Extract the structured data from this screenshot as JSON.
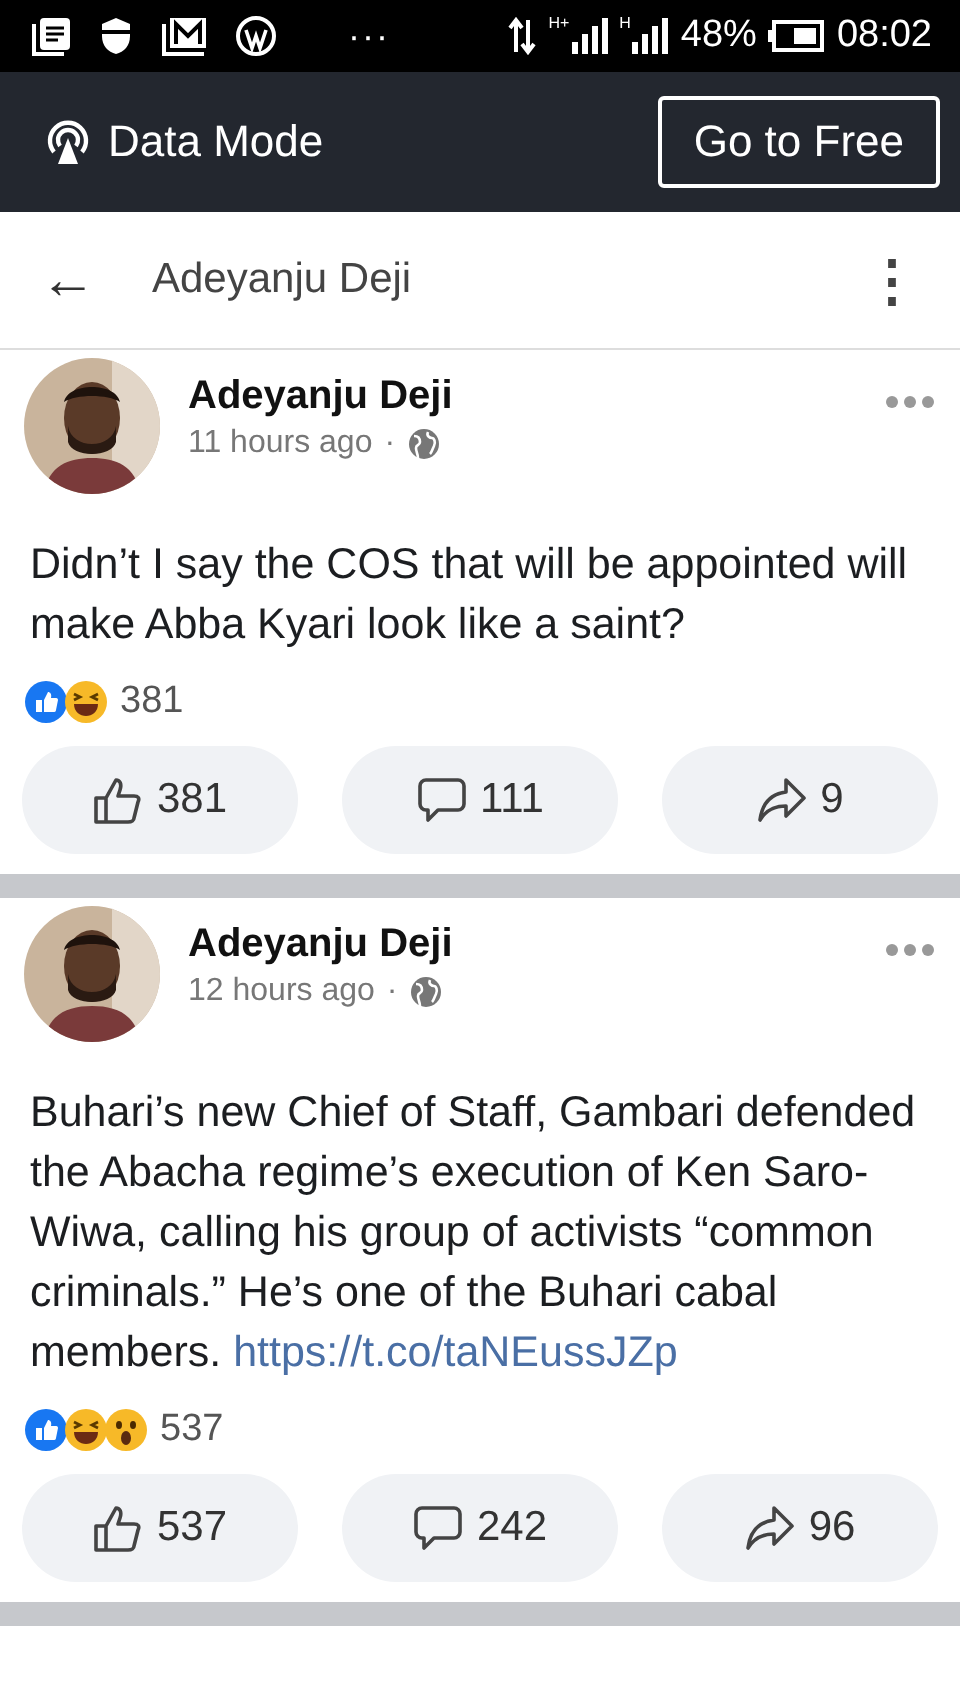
{
  "status_bar": {
    "battery": "48%",
    "time": "08:02",
    "network_labels": [
      "H+",
      "H"
    ],
    "more": "···"
  },
  "data_banner": {
    "label": "Data Mode",
    "button": "Go to Free"
  },
  "header": {
    "back": "←",
    "title": "Adeyanju Deji",
    "menu": "⋮"
  },
  "posts": [
    {
      "author": "Adeyanju Deji",
      "time": "11 hours ago",
      "separator": "·",
      "text": "Didn’t I say the COS that will be appointed will make Abba Kyari look like a saint?",
      "reactions": [
        {
          "kind": "like"
        },
        {
          "kind": "haha"
        }
      ],
      "reaction_count": "381",
      "actions": [
        {
          "kind": "like",
          "count": "381"
        },
        {
          "kind": "comment",
          "count": "111"
        },
        {
          "kind": "share",
          "count": "9"
        }
      ]
    },
    {
      "author": "Adeyanju Deji",
      "time": "12 hours ago",
      "separator": "·",
      "text": "Buhari’s new Chief of Staff, Gambari defended the Abacha regime’s execution of Ken Saro-Wiwa, calling his group of activists “common criminals.” He’s one of the Buhari cabal members.",
      "link": "https://t.co/taNEussJZp",
      "reactions": [
        {
          "kind": "like"
        },
        {
          "kind": "haha"
        },
        {
          "kind": "wow"
        }
      ],
      "reaction_count": "537",
      "actions": [
        {
          "kind": "like",
          "count": "537"
        },
        {
          "kind": "comment",
          "count": "242"
        },
        {
          "kind": "share",
          "count": "96"
        }
      ]
    }
  ]
}
